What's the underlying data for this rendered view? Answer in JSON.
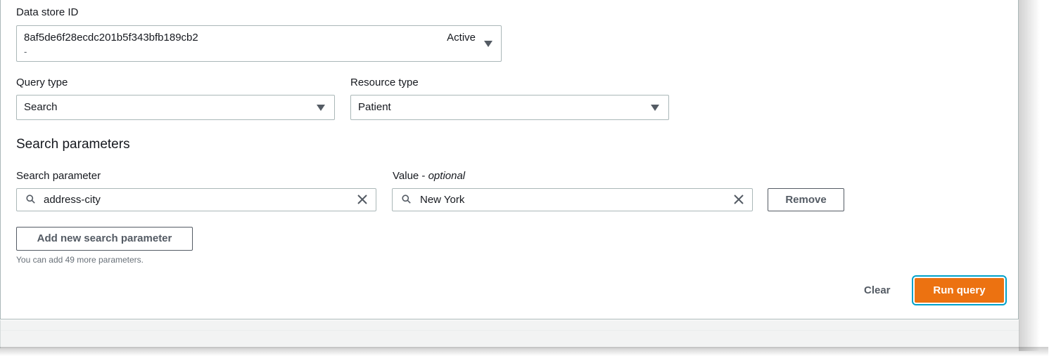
{
  "data_store": {
    "label": "Data store ID",
    "id": "8af5de6f28ecdc201b5f343bfb189cb2",
    "subtext": "-",
    "status": "Active"
  },
  "query_type": {
    "label": "Query type",
    "value": "Search"
  },
  "resource_type": {
    "label": "Resource type",
    "value": "Patient"
  },
  "search_parameters": {
    "heading": "Search parameters",
    "param_label": "Search parameter",
    "value_label": "Value - ",
    "value_label_optional": "optional",
    "param_value": "address-city",
    "value_value": "New York",
    "remove_label": "Remove",
    "add_label": "Add new search parameter",
    "hint": "You can add 49 more parameters."
  },
  "actions": {
    "clear": "Clear",
    "run": "Run query"
  },
  "colors": {
    "primary": "#ec7211",
    "focus": "#00a1c9",
    "border": "#aab7b8"
  },
  "icons": [
    "search-icon",
    "clear-icon",
    "caret-down-icon"
  ]
}
